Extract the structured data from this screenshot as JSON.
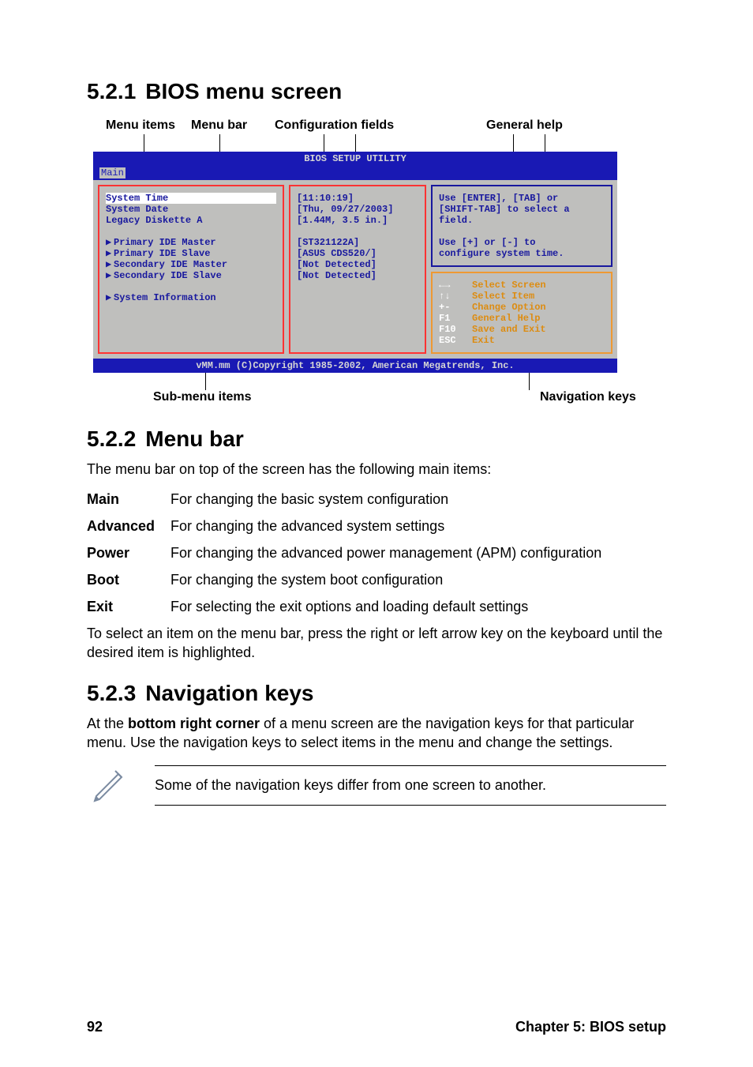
{
  "sections": {
    "s1": {
      "num": "5.2.1",
      "title": "BIOS menu screen"
    },
    "s2": {
      "num": "5.2.2",
      "title": "Menu bar"
    },
    "s3": {
      "num": "5.2.3",
      "title": "Navigation keys"
    }
  },
  "top_labels": {
    "menu_items": "Menu items",
    "menu_bar": "Menu bar",
    "config_fields": "Configuration fields",
    "general_help": "General help"
  },
  "bottom_labels": {
    "submenu": "Sub-menu items",
    "navkeys": "Navigation keys"
  },
  "bios": {
    "title": "BIOS SETUP UTILITY",
    "menubar_selected": "Main",
    "left_items": {
      "i0": "System Time",
      "i1": "System Date",
      "i2": "Legacy Diskette A",
      "i3": "Primary IDE Master",
      "i4": "Primary IDE Slave",
      "i5": "Secondary IDE Master",
      "i6": "Secondary IDE Slave",
      "i7": "System Information"
    },
    "mid_values": {
      "v0": "[11:10:19]",
      "v1": "[Thu, 09/27/2003]",
      "v2": "[1.44M, 3.5 in.]",
      "v3": "[ST321122A]",
      "v4": "[ASUS CDS520/]",
      "v5": "[Not Detected]",
      "v6": "[Not Detected]"
    },
    "help_text": "Use [ENTER], [TAB] or\n[SHIFT-TAB] to select a\nfield.\n\nUse [+] or [-] to\nconfigure system time.",
    "nav": [
      {
        "key": "←→",
        "desc": "Select Screen"
      },
      {
        "key": "↑↓",
        "desc": "Select Item"
      },
      {
        "key": "+-",
        "desc": "Change Option"
      },
      {
        "key": "F1",
        "desc": "General Help"
      },
      {
        "key": "F10",
        "desc": "Save and Exit"
      },
      {
        "key": "ESC",
        "desc": "Exit"
      }
    ],
    "footer": "vMM.mm (C)Copyright 1985-2002, American Megatrends, Inc."
  },
  "menubar_section": {
    "intro": "The menu bar on top of the screen has the following main items:",
    "items": [
      {
        "term": "Main",
        "desc": "For changing the basic system configuration"
      },
      {
        "term": "Advanced",
        "desc": "For changing the advanced system settings"
      },
      {
        "term": "Power",
        "desc": "For changing the advanced power management (APM) configuration"
      },
      {
        "term": "Boot",
        "desc": "For changing the system boot configuration"
      },
      {
        "term": "Exit",
        "desc": "For selecting the exit options and loading default settings"
      }
    ],
    "outro": "To select an item on the menu bar, press the right or left arrow key on the keyboard until the desired item is highlighted."
  },
  "navkeys_section": {
    "intro_pre": "At the ",
    "intro_bold": "bottom right corner",
    "intro_post": " of a menu screen are the navigation keys for that particular menu. Use the navigation keys to select items in the menu and change the settings.",
    "note": "Some of the navigation keys differ from one screen to another."
  },
  "footer": {
    "page": "92",
    "chapter": "Chapter 5: BIOS setup"
  }
}
